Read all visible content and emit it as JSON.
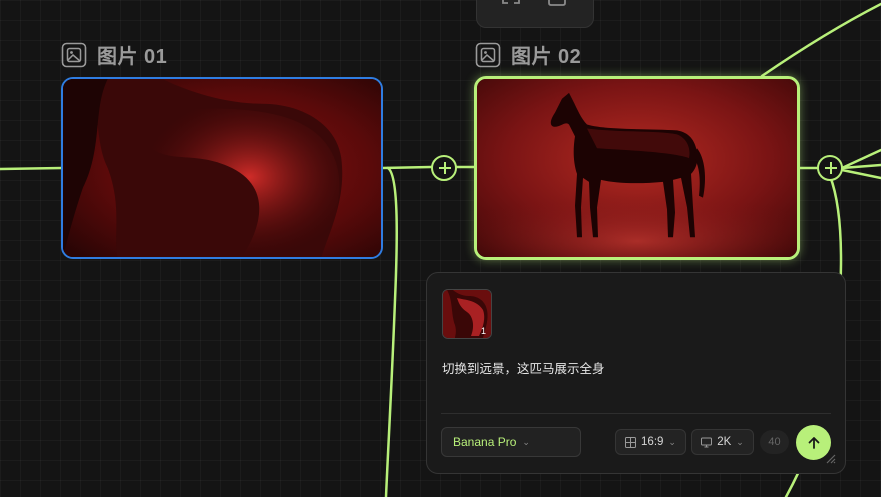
{
  "nodes": [
    {
      "title": "图片 01",
      "icon": "image-icon"
    },
    {
      "title": "图片 02",
      "icon": "image-icon"
    }
  ],
  "prompt_panel": {
    "thumbnail_badge": "1",
    "prompt_text": "切换到远景，这匹马展示全身",
    "model": "Banana Pro",
    "aspect_ratio": "16:9",
    "resolution": "2K",
    "count": "40",
    "send_icon": "arrow-up-icon"
  },
  "colors": {
    "accent": "#b8f07a",
    "selected_border": "#2f7de1",
    "background": "#141414"
  }
}
